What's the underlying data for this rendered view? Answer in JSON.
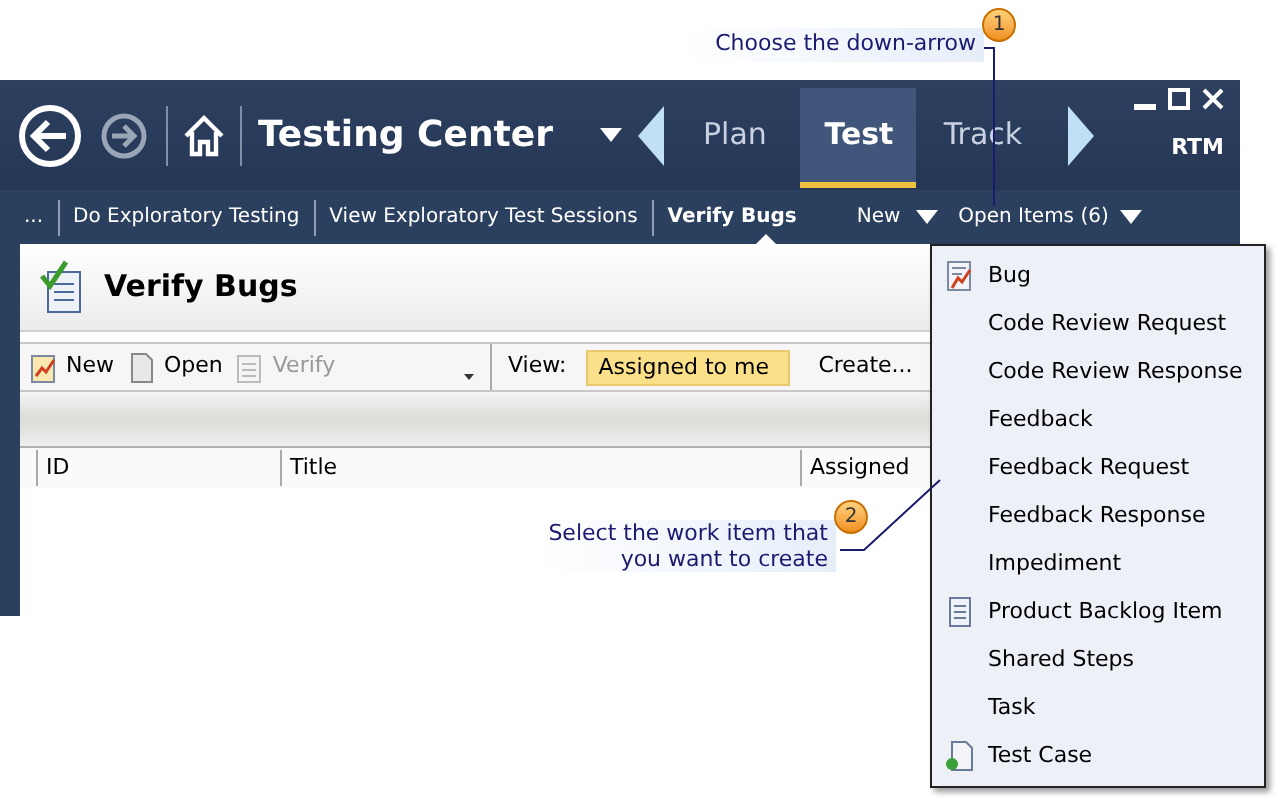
{
  "callouts": [
    {
      "number": "1",
      "text": "Choose the down-arrow"
    },
    {
      "number": "2",
      "text": "Select the work item that you want to create"
    }
  ],
  "header": {
    "title": "Testing Center",
    "tabs": [
      {
        "label": "Plan",
        "selected": false
      },
      {
        "label": "Test",
        "selected": true
      },
      {
        "label": "Track",
        "selected": false
      }
    ],
    "badge": "RTM"
  },
  "nav": {
    "items": [
      {
        "label": "...",
        "selected": false
      },
      {
        "label": "Do Exploratory Testing",
        "selected": false
      },
      {
        "label": "View Exploratory Test Sessions",
        "selected": false
      },
      {
        "label": "Verify Bugs",
        "selected": true
      }
    ],
    "new": "New",
    "open_items": "Open Items (6)"
  },
  "panel": {
    "title": "Verify Bugs",
    "toolbar": [
      {
        "label": "New",
        "kind": "new",
        "disabled": false
      },
      {
        "label": "Open",
        "kind": "open",
        "disabled": false
      },
      {
        "label": "Verify",
        "kind": "verify",
        "disabled": true
      }
    ],
    "view_label": "View:",
    "view_value": "Assigned to me",
    "create": "Create...",
    "columns": [
      "ID",
      "Title",
      "Assigned"
    ]
  },
  "menu": {
    "items": [
      {
        "label": "Bug",
        "kind": "bug"
      },
      {
        "label": "Code Review Request",
        "kind": "plain"
      },
      {
        "label": "Code Review Response",
        "kind": "plain"
      },
      {
        "label": "Feedback",
        "kind": "plain"
      },
      {
        "label": "Feedback Request",
        "kind": "plain"
      },
      {
        "label": "Feedback Response",
        "kind": "plain"
      },
      {
        "label": "Impediment",
        "kind": "plain"
      },
      {
        "label": "Product Backlog Item",
        "kind": "document"
      },
      {
        "label": "Shared Steps",
        "kind": "plain"
      },
      {
        "label": "Task",
        "kind": "plain"
      },
      {
        "label": "Test Case",
        "kind": "testcase"
      }
    ]
  }
}
